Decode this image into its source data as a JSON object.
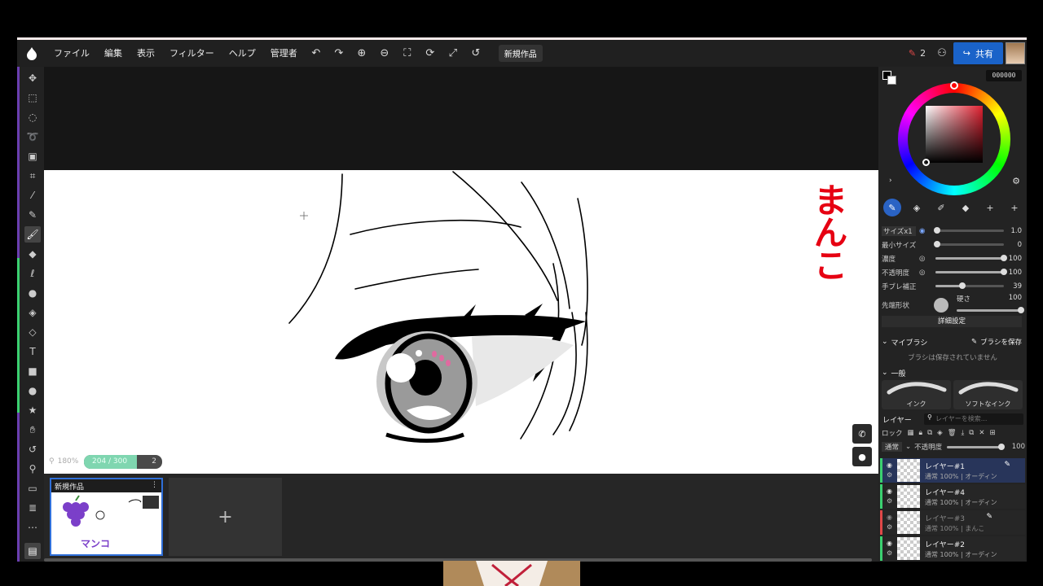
{
  "menu": {
    "items": [
      "ファイル",
      "編集",
      "表示",
      "フィルター",
      "ヘルプ",
      "管理者"
    ],
    "doc_title": "新規作品",
    "notification_count": "2",
    "share_label": "共有"
  },
  "colors": {
    "accent": "#1a63c9",
    "brush_badge": "#7fd6b0",
    "ink_red": "#e60012",
    "ink_purple": "#7b3fc9"
  },
  "canvas": {
    "zoom": "180%",
    "brush_progress": "204 / 300",
    "brush_progress_fraction": 0.68,
    "brush_count": "2",
    "red_text": "まんこ"
  },
  "filmstrip": {
    "thumb_title": "新規作品",
    "thumb_text": "マンコ",
    "add_label": "+"
  },
  "color_panel": {
    "hex": "000000"
  },
  "brush": {
    "size_label": "サイズx1",
    "size_value": "1.0",
    "min_size_label": "最小サイズ",
    "min_size_value": "0",
    "density_label": "濃度",
    "density_value": "100",
    "opacity_label": "不透明度",
    "opacity_value": "100",
    "stabilizer_label": "手ブレ補正",
    "stabilizer_value": "39",
    "tip_shape_label": "先端形状",
    "hardness_label": "硬さ",
    "hardness_value": "100",
    "detail_label": "詳細設定",
    "stabilizer_fraction": 0.39
  },
  "my_brush": {
    "header": "マイブラシ",
    "save_label": "ブラシを保存",
    "empty_message": "ブラシは保存されていません",
    "general_header": "一般",
    "presets": [
      "インク",
      "ソフトなインク"
    ]
  },
  "layers": {
    "header": "レイヤー",
    "search_placeholder": "レイヤーを検索...",
    "lock_label": "ロック",
    "blend_mode": "通常",
    "opacity_label": "不透明度",
    "opacity_value": "100",
    "items": [
      {
        "name": "レイヤー#1",
        "sub": "通常 100% | オーディン",
        "edge": "#3bd070"
      },
      {
        "name": "レイヤー#4",
        "sub": "通常 100% | オーディン",
        "edge": "#3bd070"
      },
      {
        "name": "レイヤー#3",
        "sub": "通常 100% | まんこ",
        "edge": "#e04848"
      },
      {
        "name": "レイヤー#2",
        "sub": "通常 100% | オーディン",
        "edge": "#3bd070"
      }
    ]
  }
}
